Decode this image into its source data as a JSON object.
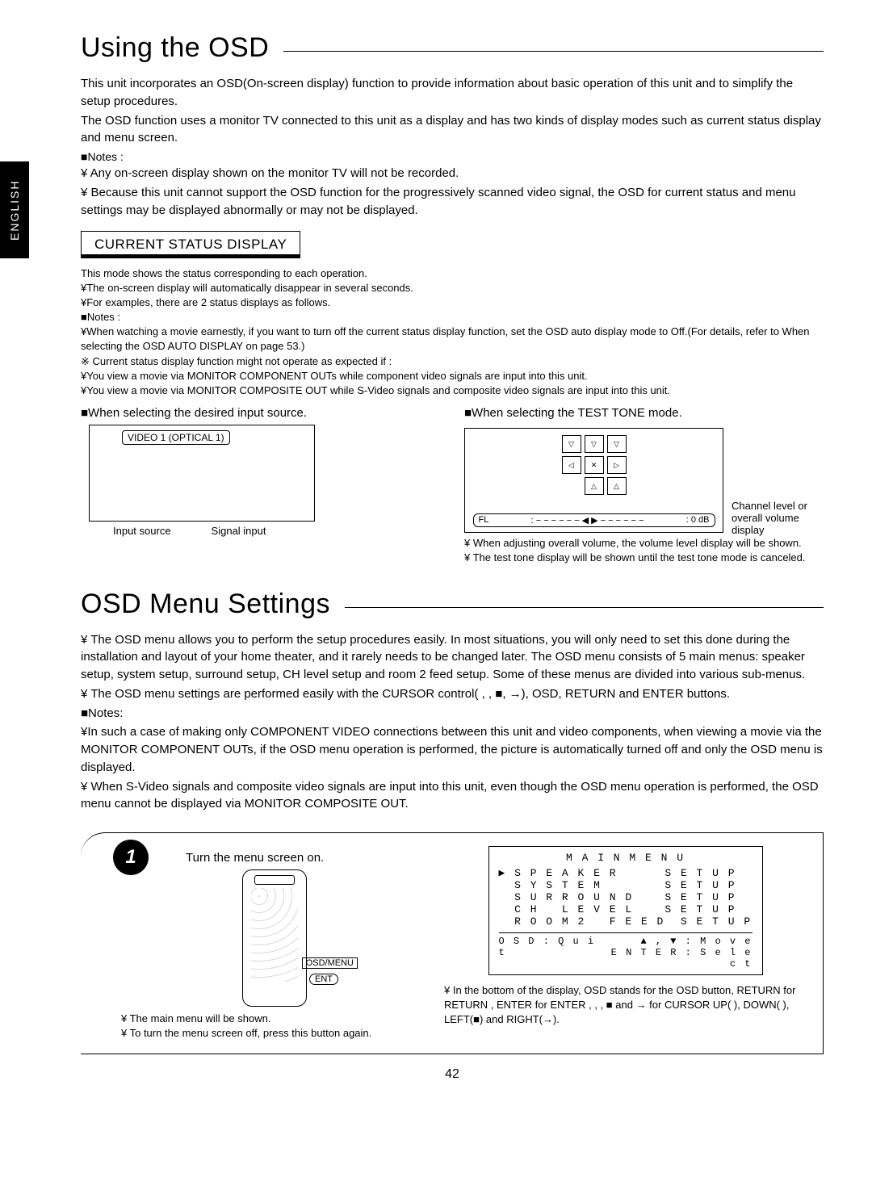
{
  "sidetab": "ENGLISH",
  "section1_title": "Using the OSD",
  "intro1": "This unit incorporates an OSD(On-screen display) function to provide information about basic operation of this unit and to simplify the setup procedures.",
  "intro2": "The OSD function uses a monitor TV connected to this unit as a display and has two kinds of display modes such as current status display and menu screen.",
  "notes_label": "■Notes :",
  "note1": "¥ Any on-screen display shown on the monitor TV will not be recorded.",
  "note2": "¥ Because this unit cannot support the OSD function for the progressively scanned video signal, the OSD for current status and menu settings may be displayed abnormally or may not be displayed.",
  "sub_heading": "CURRENT STATUS DISPLAY",
  "cs1": "This mode shows the status corresponding to each operation.",
  "cs2": "¥The on-screen display will automatically disappear in several seconds.",
  "cs3": "¥For examples, there are 2 status displays as follows.",
  "cs_notes_label": "■Notes :",
  "cs4": "¥When watching a movie earnestly, if you want to turn off the current status display function, set the OSD auto display mode to Off.(For details, refer to  When selecting the OSD AUTO DISPLAY  on page 53.)",
  "cs5": "※ Current status display function might not operate as expected if :",
  "cs6": "¥You view a movie via MONITOR COMPONENT OUTs while component video signals are input into this unit.",
  "cs7": "¥You view a movie via MONITOR COMPOSITE OUT while S-Video signals and composite video signals are input into this unit.",
  "diag_left_title": "■When selecting the desired input source.",
  "diag_left_box": "VIDEO 1  (OPTICAL 1)",
  "diag_left_under_l": "Input source",
  "diag_left_under_r": "Signal input",
  "diag_right_title": "■When selecting the TEST TONE mode.",
  "diag_bar_left": "FL",
  "diag_bar_mid": ": − − − − − − ◀ ▶ − − − − − −",
  "diag_bar_right": ":  0 dB",
  "diag_legend1": "Channel level or",
  "diag_legend2": "overall volume display",
  "diag_right_note1": "¥ When adjusting overall volume, the volume level display will be shown.",
  "diag_right_note2": "¥ The test tone display will be shown until the test tone mode is canceled.",
  "section2_title": "OSD Menu Settings",
  "osd1": "¥ The OSD menu allows you to perform the setup procedures easily. In most situations, you will only need to set this done during the installation and layout of your home theater, and it rarely needs to be changed later. The OSD menu consists of 5 main menus: speaker setup, system setup, surround setup, CH  level setup and room 2 feed setup. Some of these menus are divided into various sub-menus.",
  "osd2": "¥ The OSD menu settings are performed easily with the CURSOR control(  ,  , ■, →), OSD, RETURN and ENTER buttons.",
  "osd_notes_label": "■Notes:",
  "osd3": "¥In such a case of making only COMPONENT VIDEO connections between this unit and video components, when viewing a movie via the MONITOR COMPONENT OUTs, if the OSD menu operation is performed, the picture is automatically turned off and only the OSD menu is displayed.",
  "osd4": "¥ When S-Video signals and composite video signals are input into this unit, even though the OSD menu operation is performed, the OSD menu cannot be displayed via MONITOR COMPOSITE OUT.",
  "step_num": "1",
  "step_title": "Turn the menu screen on.",
  "remote_btn1": "OSD/MENU",
  "remote_btn2": "ENT",
  "step_left_note1": "¥ The main menu will be shown.",
  "step_left_note2": "¥ To turn the menu screen off, press this button again.",
  "menu_title": "M A I N    M E N U",
  "menu_r1": "▶ S P E A K E R      S E T U P",
  "menu_r2": "  S Y S T E M        S E T U P",
  "menu_r3": "  S U R R O U N D    S E T U P",
  "menu_r4": "  C H   L E V E L    S E T U P",
  "menu_r5": "  R O O M 2   F E E D  S E T U P",
  "menu_footer_l": "O S D : Q u i t",
  "menu_footer_rtop": "▲ , ▼ : M o v e",
  "menu_footer_rbot": "E N T E R : S e l e c t",
  "step_right_note1": "¥ In the bottom of the display,  OSD  stands for the OSD button,  RETURN  for  RETURN ,  ENTER  for ENTER ,     ,     ,  ■  and  →  for CURSOR UP(   ), DOWN(   ), LEFT(■) and RIGHT(→).",
  "pagenum": "42"
}
